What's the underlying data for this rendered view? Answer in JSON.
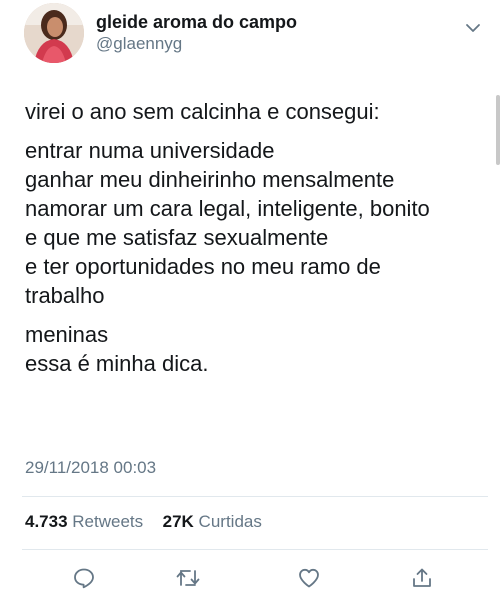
{
  "author": {
    "display_name": "gleide aroma do campo",
    "handle": "@glaennyg",
    "avatar_icon": "profile-photo"
  },
  "tweet": {
    "paragraphs": [
      [
        "virei o ano sem calcinha e consegui:"
      ],
      [
        "entrar numa universidade",
        "ganhar meu dinheirinho mensalmente",
        "namorar um cara legal, inteligente, bonito",
        "e que me satisfaz sexualmente",
        "e ter oportunidades no meu ramo de",
        "trabalho"
      ],
      [
        "meninas",
        "essa é minha dica."
      ]
    ],
    "timestamp": "29/11/2018 00:03"
  },
  "stats": {
    "retweets_count": "4.733",
    "retweets_label": "Retweets",
    "likes_count": "27K",
    "likes_label": "Curtidas"
  },
  "actions": [
    {
      "name": "reply-icon"
    },
    {
      "name": "retweet-icon"
    },
    {
      "name": "like-icon"
    },
    {
      "name": "share-icon"
    }
  ],
  "colors": {
    "text": "#14171a",
    "secondary": "#657786",
    "divider": "#e1e8ed"
  }
}
